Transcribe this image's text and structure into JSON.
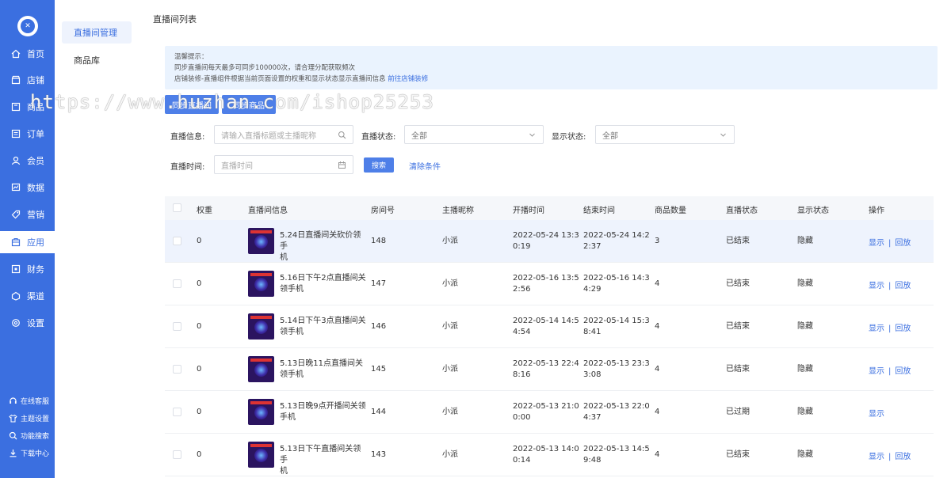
{
  "nav": {
    "items": [
      {
        "label": "首页",
        "icon": "home-icon"
      },
      {
        "label": "店铺",
        "icon": "store-icon"
      },
      {
        "label": "商品",
        "icon": "goods-icon"
      },
      {
        "label": "订单",
        "icon": "order-icon"
      },
      {
        "label": "会员",
        "icon": "user-icon"
      },
      {
        "label": "数据",
        "icon": "chart-icon"
      },
      {
        "label": "营销",
        "icon": "tag-icon"
      },
      {
        "label": "应用",
        "icon": "app-icon"
      },
      {
        "label": "财务",
        "icon": "finance-icon"
      },
      {
        "label": "渠道",
        "icon": "channel-icon"
      },
      {
        "label": "设置",
        "icon": "gear-icon"
      }
    ],
    "utils": [
      {
        "label": "在线客服",
        "icon": "headset-icon"
      },
      {
        "label": "主题设置",
        "icon": "shirt-icon"
      },
      {
        "label": "功能搜索",
        "icon": "search-icon"
      },
      {
        "label": "下载中心",
        "icon": "download-icon"
      }
    ]
  },
  "submenu": {
    "items": [
      "直播间管理",
      "商品库"
    ]
  },
  "page": {
    "title": "直播间列表"
  },
  "tip": {
    "title": "温馨提示：",
    "line1": "同步直播间每天最多可同步100000次，请合理分配获取频次",
    "line2": "店铺装修-直播组件根据当前页面设置的权重和显示状态显示直播间信息",
    "line2_link": "前往店铺装修"
  },
  "toolbar": {
    "btn1": "同步直播间",
    "btn2": "同步商品"
  },
  "watermark": "https://www.huzhan.com/ishop25253",
  "filters": {
    "info_label": "直播信息:",
    "info_placeholder": "请输入直播标题或主播昵称",
    "status_label": "直播状态:",
    "status_value": "全部",
    "show_label": "显示状态:",
    "show_value": "全部",
    "time_label": "直播时间:",
    "time_placeholder": "直播时间",
    "search_btn": "搜索",
    "clear_link": "清除条件"
  },
  "table": {
    "headers": [
      "权重",
      "直播间信息",
      "房间号",
      "主播昵称",
      "开播时间",
      "结束时间",
      "商品数量",
      "直播状态",
      "显示状态",
      "操作"
    ],
    "rows": [
      {
        "weight": "0",
        "title1": "5.24日直播间关砍价领手",
        "title2": "机",
        "room": "148",
        "anchor": "小派",
        "start1": "2022-05-24 13:3",
        "start2": "0:19",
        "end1": "2022-05-24 14:2",
        "end2": "2:37",
        "count": "3",
        "status": "已结束",
        "show": "隐藏",
        "act1": "显示",
        "act2": "回放"
      },
      {
        "weight": "0",
        "title1": "5.16日下午2点直播间关",
        "title2": "领手机",
        "room": "147",
        "anchor": "小派",
        "start1": "2022-05-16 13:5",
        "start2": "2:56",
        "end1": "2022-05-16 14:3",
        "end2": "4:29",
        "count": "4",
        "status": "已结束",
        "show": "隐藏",
        "act1": "显示",
        "act2": "回放"
      },
      {
        "weight": "0",
        "title1": "5.14日下午3点直播间关",
        "title2": "领手机",
        "room": "146",
        "anchor": "小派",
        "start1": "2022-05-14 14:5",
        "start2": "4:54",
        "end1": "2022-05-14 15:3",
        "end2": "8:41",
        "count": "4",
        "status": "已结束",
        "show": "隐藏",
        "act1": "显示",
        "act2": "回放"
      },
      {
        "weight": "0",
        "title1": "5.13日晚11点直播间关",
        "title2": "领手机",
        "room": "145",
        "anchor": "小派",
        "start1": "2022-05-13 22:4",
        "start2": "8:16",
        "end1": "2022-05-13 23:3",
        "end2": "3:08",
        "count": "4",
        "status": "已结束",
        "show": "隐藏",
        "act1": "显示",
        "act2": "回放"
      },
      {
        "weight": "0",
        "title1": "5.13日晚9点开播间关领",
        "title2": "手机",
        "room": "144",
        "anchor": "小派",
        "start1": "2022-05-13 21:0",
        "start2": "0:00",
        "end1": "2022-05-13 22:0",
        "end2": "4:37",
        "count": "4",
        "status": "已过期",
        "show": "隐藏",
        "act1": "显示",
        "act2": ""
      },
      {
        "weight": "0",
        "title1": "5.13日下午直播间关领手",
        "title2": "机",
        "room": "143",
        "anchor": "小派",
        "start1": "2022-05-13 14:0",
        "start2": "0:14",
        "end1": "2022-05-13 14:5",
        "end2": "9:48",
        "count": "4",
        "status": "已结束",
        "show": "隐藏",
        "act1": "显示",
        "act2": "回放"
      }
    ]
  }
}
